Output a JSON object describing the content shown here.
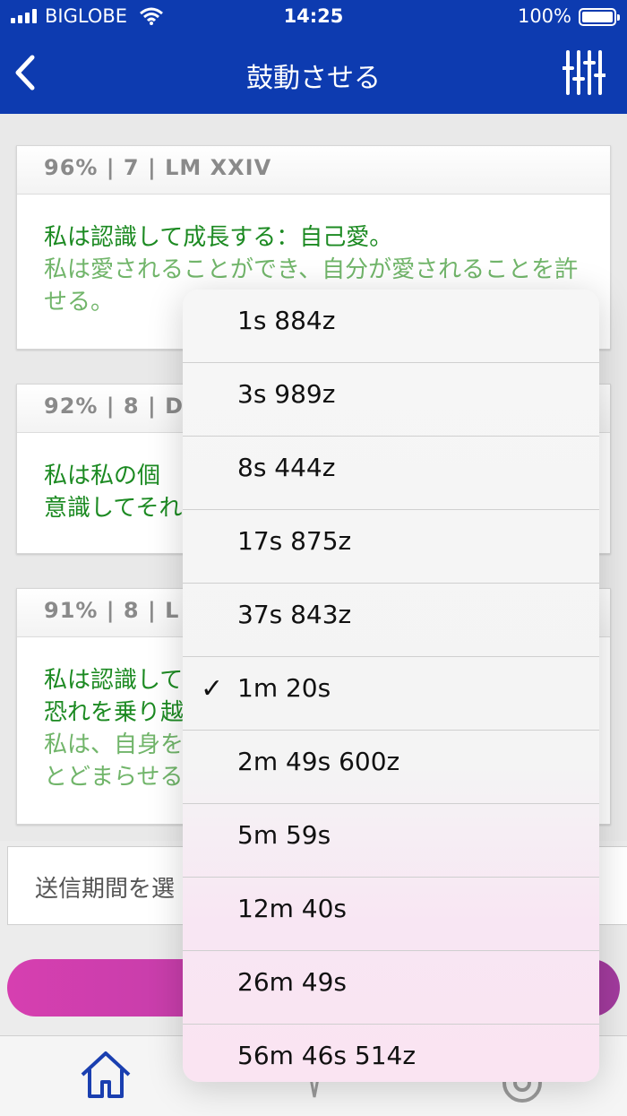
{
  "status_bar": {
    "carrier": "BIGLOBE",
    "time": "14:25",
    "battery": "100%"
  },
  "nav": {
    "title": "鼓動させる"
  },
  "cards": [
    {
      "header": "96% | 7 | LM XXIV",
      "line1": "私は認識して成長する：自己愛。",
      "line2": "私は愛されることができ、自分が愛されることを許せる。"
    },
    {
      "header": "92% | 8 | D",
      "line1": "私は私の個",
      "line2": "意識してそれ"
    },
    {
      "header": "91% | 8 | L",
      "line1": "私は認識して",
      "line2": "恐れを乗り越",
      "line3": "私は、自身を",
      "line4": "とどまらせる"
    }
  ],
  "input": {
    "placeholder": "送信期間を選"
  },
  "dropdown": {
    "selected": "1m 20s",
    "options": [
      "1s 884z",
      "3s 989z",
      "8s 444z",
      "17s 875z",
      "37s 843z",
      "1m 20s",
      "2m 49s 600z",
      "5m 59s",
      "12m 40s",
      "26m 49s",
      "56m 46s 514z"
    ]
  },
  "icons": {
    "back": "chevron-left-icon",
    "filter": "sliders-icon",
    "home": "home-icon",
    "settings": "gear-icon",
    "check": "checkmark-icon"
  },
  "colors": {
    "nav_bg": "#0d3bb0",
    "text_primary_green": "#1c8a22",
    "text_secondary_green": "#71b56a",
    "button_gradient_start": "#d63fb0",
    "button_gradient_end": "#a23b9e"
  }
}
